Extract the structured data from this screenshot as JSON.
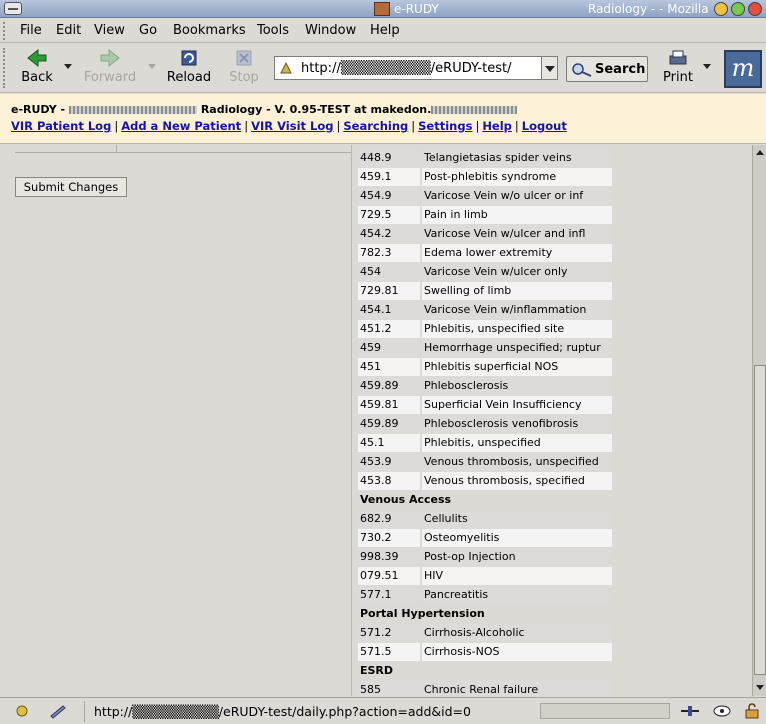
{
  "window": {
    "title_left": "e-RUDY",
    "title_right": "Radiology - - Mozilla"
  },
  "menu": [
    "File",
    "Edit",
    "View",
    "Go",
    "Bookmarks",
    "Tools",
    "Window",
    "Help"
  ],
  "toolbar": {
    "back": "Back",
    "forward": "Forward",
    "reload": "Reload",
    "stop": "Stop",
    "url": "http://▒▒▒▒▒▒▒▒▒/eRUDY-test/",
    "search": "Search",
    "print": "Print",
    "logo": "m"
  },
  "header": {
    "brand": "e-RUDY -",
    "title": "Radiology - V. 0.95-TEST at makedon.",
    "links": [
      "VIR Patient Log",
      "Add a New Patient",
      "VIR Visit Log",
      "Searching",
      "Settings",
      "Help",
      "Logout"
    ]
  },
  "form": {
    "submit_label": "Submit Changes"
  },
  "codes": [
    {
      "code": "448.9",
      "desc": "Telangietasias spider veins"
    },
    {
      "code": "459.1",
      "desc": "Post-phlebitis syndrome"
    },
    {
      "code": "454.9",
      "desc": "Varicose Vein w/o ulcer or inf"
    },
    {
      "code": "729.5",
      "desc": "Pain in limb"
    },
    {
      "code": "454.2",
      "desc": "Varicose Vein w/ulcer and infl"
    },
    {
      "code": "782.3",
      "desc": "Edema lower extremity"
    },
    {
      "code": "454",
      "desc": "Varicose Vein w/ulcer only"
    },
    {
      "code": "729.81",
      "desc": "Swelling of limb"
    },
    {
      "code": "454.1",
      "desc": "Varicose Vein w/inflammation"
    },
    {
      "code": "451.2",
      "desc": "Phlebitis, unspecified site"
    },
    {
      "code": "459",
      "desc": "Hemorrhage unspecified; ruptur"
    },
    {
      "code": "451",
      "desc": "Phlebitis superficial NOS"
    },
    {
      "code": "459.89",
      "desc": "Phlebosclerosis"
    },
    {
      "code": "459.81",
      "desc": "Superficial Vein Insufficiency"
    },
    {
      "code": "459.89",
      "desc": "Phlebosclerosis venofibrosis"
    },
    {
      "code": "45.1",
      "desc": "Phlebitis, unspecified"
    },
    {
      "code": "453.9",
      "desc": "Venous thrombosis, unspecified"
    },
    {
      "code": "453.8",
      "desc": "Venous thrombosis, specified"
    },
    {
      "section": "Venous Access"
    },
    {
      "code": "682.9",
      "desc": "Cellulits"
    },
    {
      "code": "730.2",
      "desc": "Osteomyelitis"
    },
    {
      "code": "998.39",
      "desc": "Post-op Injection"
    },
    {
      "code": "079.51",
      "desc": "HIV"
    },
    {
      "code": "577.1",
      "desc": "Pancreatitis"
    },
    {
      "section": "Portal Hypertension"
    },
    {
      "code": "571.2",
      "desc": "Cirrhosis-Alcoholic"
    },
    {
      "code": "571.5",
      "desc": "Cirrhosis-NOS"
    },
    {
      "section": "ESRD"
    },
    {
      "code": "585",
      "desc": "Chronic Renal failure"
    }
  ],
  "status": {
    "url": "http://▒▒▒▒▒▒▒▒▒/eRUDY-test/daily.php?action=add&id=0"
  }
}
